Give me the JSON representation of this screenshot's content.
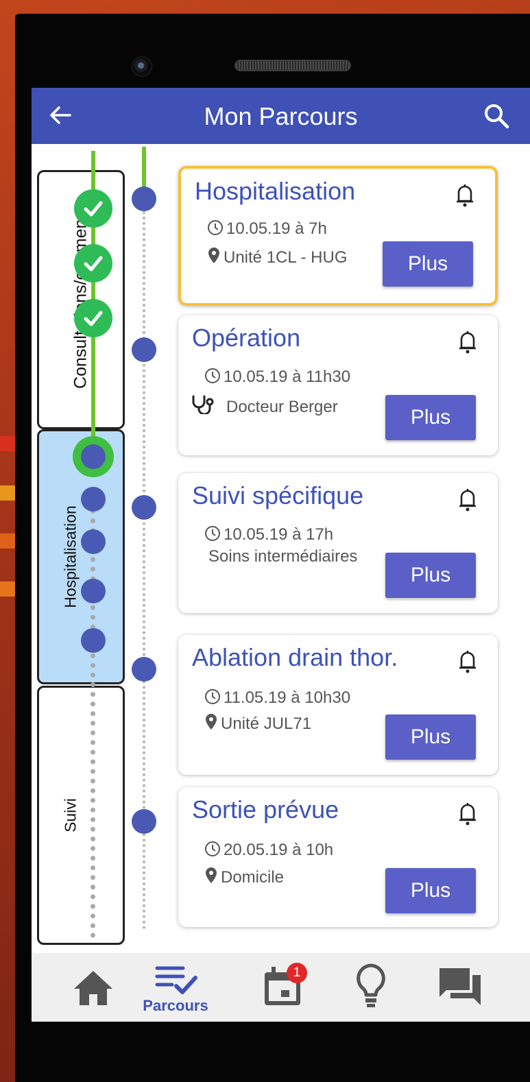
{
  "app": {
    "title": "Mon Parcours",
    "back_icon": "arrow-left-icon",
    "search_icon": "search-icon",
    "primary_color": "#3f51b5"
  },
  "phases": [
    {
      "label": "Consultations/examens",
      "state": "done"
    },
    {
      "label": "Hospitalisation",
      "state": "current"
    },
    {
      "label": "Suivi",
      "state": "upcoming"
    }
  ],
  "events": [
    {
      "title": "Hospitalisation",
      "datetime": "10.05.19 à 7h",
      "detail_icon": "location-pin-icon",
      "detail": "Unité 1CL - HUG",
      "button": "Plus",
      "highlighted": true
    },
    {
      "title": "Opération",
      "datetime": "10.05.19 à 11h30",
      "detail_icon": "stethoscope-icon",
      "detail": "Docteur Berger",
      "button": "Plus",
      "highlighted": false
    },
    {
      "title": "Suivi spécifique",
      "datetime": "10.05.19 à 17h",
      "detail_icon": "none",
      "detail": "Soins intermédiaires",
      "button": "Plus",
      "highlighted": false
    },
    {
      "title": "Ablation drain thor.",
      "datetime": "11.05.19 à 10h30",
      "detail_icon": "location-pin-icon",
      "detail": "Unité JUL71",
      "button": "Plus",
      "highlighted": false
    },
    {
      "title": "Sortie prévue",
      "datetime": "20.05.19 à 10h",
      "detail_icon": "location-pin-icon",
      "detail": "Domicile",
      "button": "Plus",
      "highlighted": false
    }
  ],
  "bottom_nav": [
    {
      "icon": "home-icon",
      "label": ""
    },
    {
      "icon": "checklist-icon",
      "label": "Parcours",
      "active": true
    },
    {
      "icon": "calendar-icon",
      "label": "",
      "badge": "1"
    },
    {
      "icon": "lightbulb-icon",
      "label": ""
    },
    {
      "icon": "chat-icon",
      "label": ""
    }
  ]
}
